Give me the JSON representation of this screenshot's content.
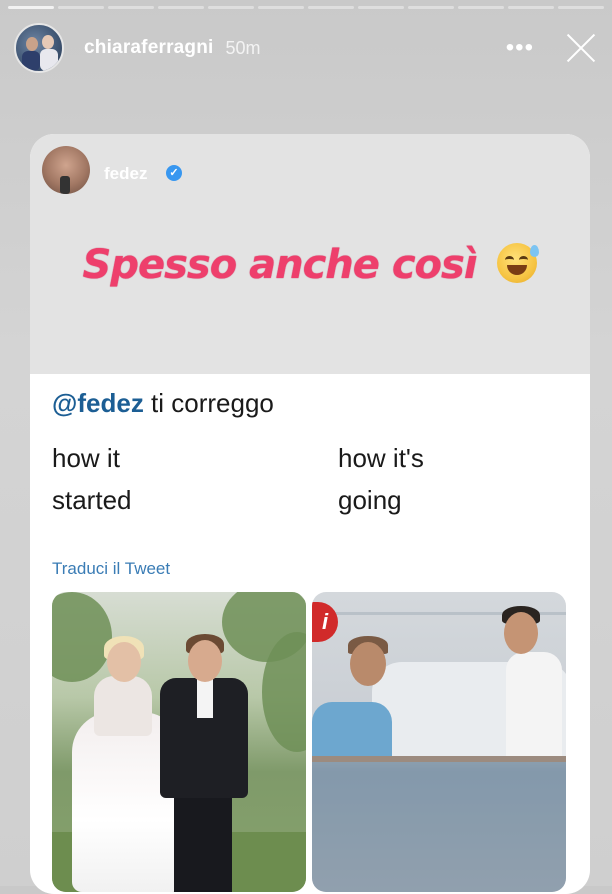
{
  "story": {
    "username": "chiaraferragni",
    "time": "50m",
    "more_icon": "more-dots-icon",
    "close_icon": "close-x-icon"
  },
  "card": {
    "author": "fedez",
    "verified_icon": "verified-badge-icon",
    "sticker_text": "Spesso anche così",
    "sticker_emoji": "grinning-sweat-emoji",
    "sticker_color": "#ee3f6c"
  },
  "tweet": {
    "mention": "@fedez",
    "text": "ti correggo",
    "left_caption_line1": "how it",
    "left_caption_line2": "started",
    "right_caption_line1": "how it's",
    "right_caption_line2": "going",
    "translate_link": "Traduci il Tweet",
    "link_color": "#3a7cb5"
  }
}
